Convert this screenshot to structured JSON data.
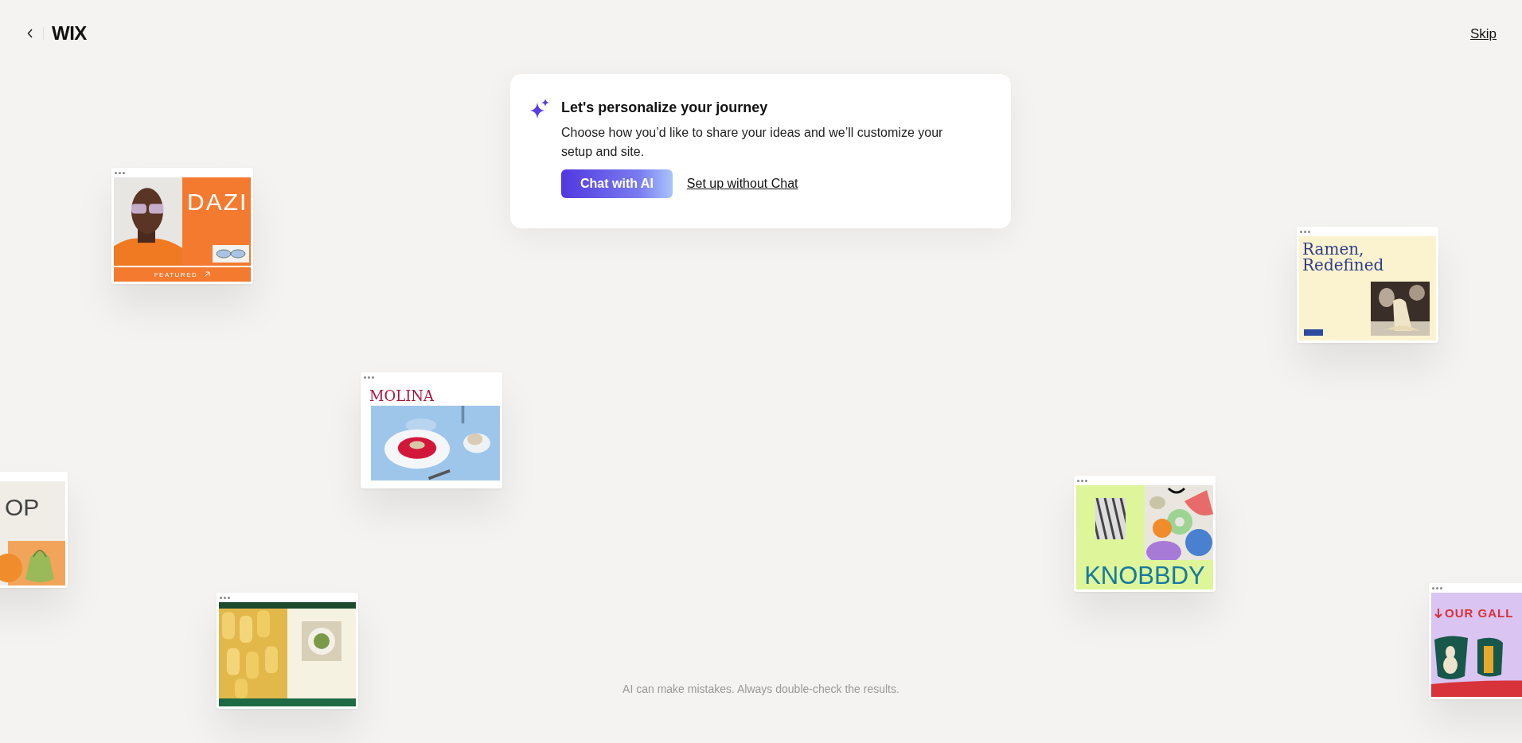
{
  "header": {
    "logo": "WIX",
    "skip": "Skip"
  },
  "dialog": {
    "title": "Let's personalize your journey",
    "body": "Choose how you’d like to share your ideas and we’ll customize your setup and site.",
    "primary": "Chat with AI",
    "secondary": "Set up without Chat"
  },
  "templates": [
    {
      "kind": "fashion",
      "title": "DAZI",
      "label": "FEATURED"
    },
    {
      "kind": "restaurant",
      "title": "MOLINA"
    },
    {
      "kind": "ramen",
      "title": "Ramen, Redefined"
    },
    {
      "kind": "design",
      "title": "KNOBBDY"
    },
    {
      "kind": "shop",
      "title": "OP"
    },
    {
      "kind": "pasta"
    },
    {
      "kind": "gallery",
      "title": "OUR GALL"
    }
  ],
  "disclaimer": "AI can make mistakes. Always double-check the results."
}
